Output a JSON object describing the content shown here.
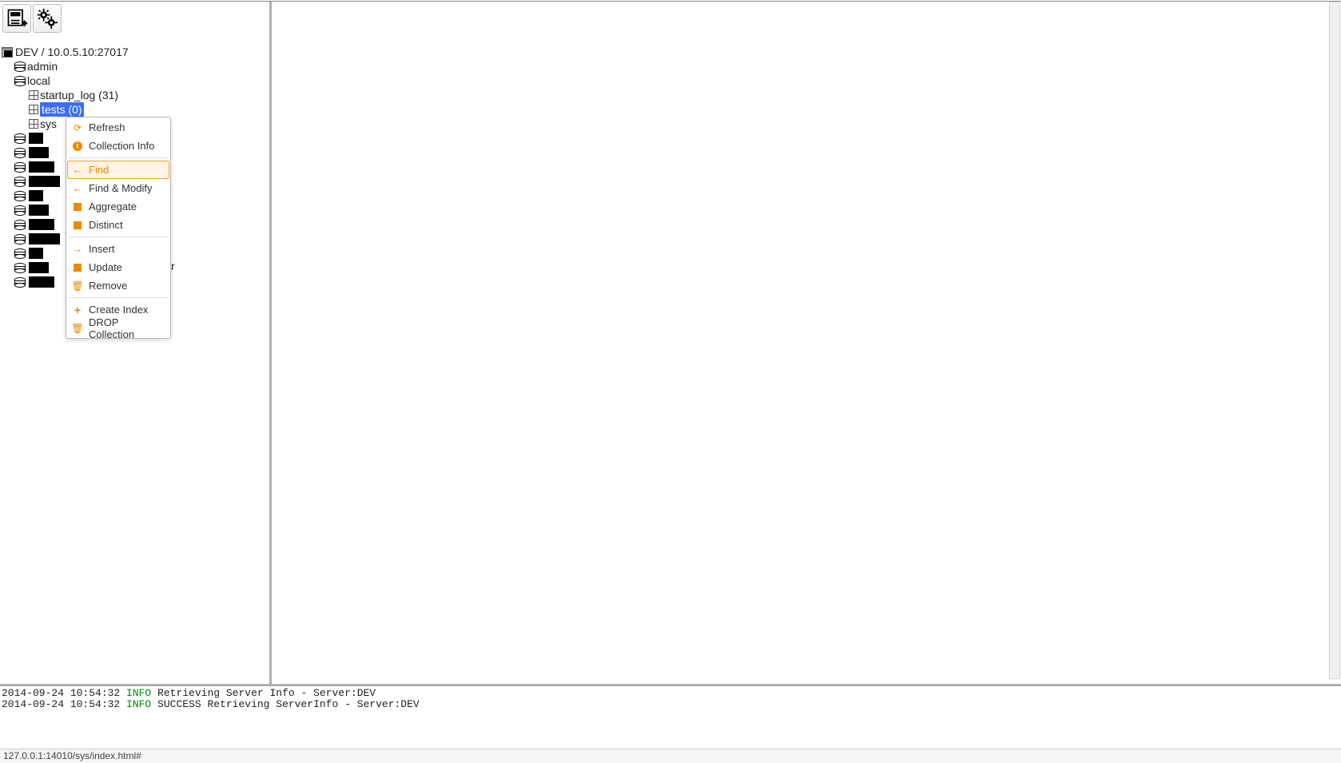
{
  "toolbar": {
    "add_server_tooltip": "Add Server",
    "settings_tooltip": "Settings"
  },
  "tree": {
    "server_label": "DEV / 10.0.5.10:27017",
    "databases": [
      {
        "name": "admin"
      },
      {
        "name": "local",
        "collections": [
          {
            "label": "startup_log (31)"
          },
          {
            "label": "tests (0)",
            "selected": true
          },
          {
            "label": "sys"
          }
        ]
      }
    ],
    "redacted_rows": 11,
    "stray_char": "r"
  },
  "context_menu": {
    "groups": [
      [
        {
          "key": "refresh",
          "label": "Refresh",
          "icon": "refresh"
        },
        {
          "key": "collection-info",
          "label": "Collection Info",
          "icon": "info"
        }
      ],
      [
        {
          "key": "find",
          "label": "Find",
          "icon": "arrow-left",
          "hovered": true
        },
        {
          "key": "find-modify",
          "label": "Find & Modify",
          "icon": "arrow-left"
        },
        {
          "key": "aggregate",
          "label": "Aggregate",
          "icon": "square"
        },
        {
          "key": "distinct",
          "label": "Distinct",
          "icon": "square"
        }
      ],
      [
        {
          "key": "insert",
          "label": "Insert",
          "icon": "arrow-right"
        },
        {
          "key": "update",
          "label": "Update",
          "icon": "square"
        },
        {
          "key": "remove",
          "label": "Remove",
          "icon": "trash"
        }
      ],
      [
        {
          "key": "create-index",
          "label": "Create Index",
          "icon": "plus"
        },
        {
          "key": "drop-collection",
          "label": "DROP Collection",
          "icon": "trash"
        }
      ]
    ]
  },
  "log": {
    "lines": [
      {
        "ts": "2014-09-24 10:54:32",
        "level": "INFO",
        "msg": "Retrieving Server Info - Server:DEV"
      },
      {
        "ts": "2014-09-24 10:54:32",
        "level": "INFO",
        "msg": "SUCCESS Retrieving ServerInfo - Server:DEV"
      }
    ]
  },
  "status_bar": {
    "text": "127.0.0.1:14010/sys/index.html#"
  }
}
